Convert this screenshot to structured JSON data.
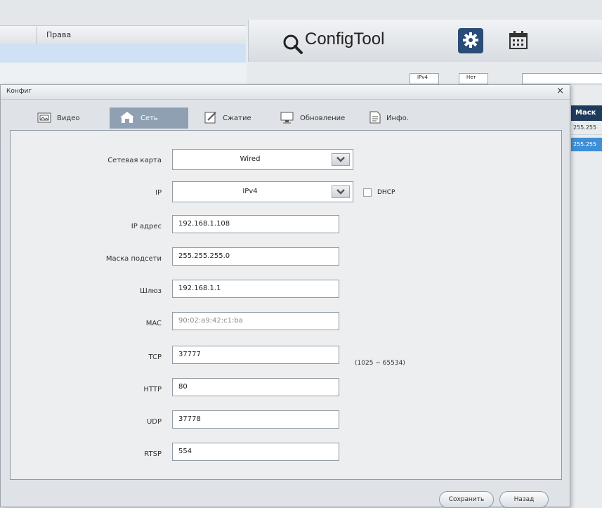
{
  "background": {
    "rights_column": "Права",
    "app_title": "ConfigTool",
    "filters": [
      "IPv4",
      "Нет"
    ],
    "grid_header": "Маск",
    "grid_rows": [
      "255.255",
      "255.255"
    ]
  },
  "dialog": {
    "title": "Конфиг",
    "close_label": "×",
    "tabs": [
      {
        "label": "Видео",
        "icon": "video-icon"
      },
      {
        "label": "Сеть",
        "icon": "network-icon",
        "active": true
      },
      {
        "label": "Сжатие",
        "icon": "compress-icon"
      },
      {
        "label": "Обновление",
        "icon": "update-icon"
      },
      {
        "label": "Инфо.",
        "icon": "info-icon"
      }
    ],
    "fields": {
      "netcard": {
        "label": "Сетевая карта",
        "value": "Wired"
      },
      "ip_mode": {
        "label": "IP",
        "value": "IPv4"
      },
      "dhcp": {
        "label": "DHCP",
        "checked": false
      },
      "ip_address": {
        "label": "IP адрес",
        "value": "192.168.1.108"
      },
      "subnet_mask": {
        "label": "Маска подсети",
        "value": "255.255.255.0"
      },
      "gateway": {
        "label": "Шлюз",
        "value": "192.168.1.1"
      },
      "mac": {
        "label": "MAC",
        "value": "90:02:a9:42:c1:ba"
      },
      "tcp": {
        "label": "TCP",
        "value": "37777",
        "range": "(1025 ~ 65534)"
      },
      "http": {
        "label": "HTTP",
        "value": "80"
      },
      "udp": {
        "label": "UDP",
        "value": "37778"
      },
      "rtsp": {
        "label": "RTSP",
        "value": "554"
      }
    },
    "buttons": {
      "save": "Сохранить",
      "back": "Назад"
    }
  },
  "colors": {
    "accent": "#2a4c78",
    "active_tab": "#8fa0b3",
    "selection": "#3f8fd6"
  }
}
